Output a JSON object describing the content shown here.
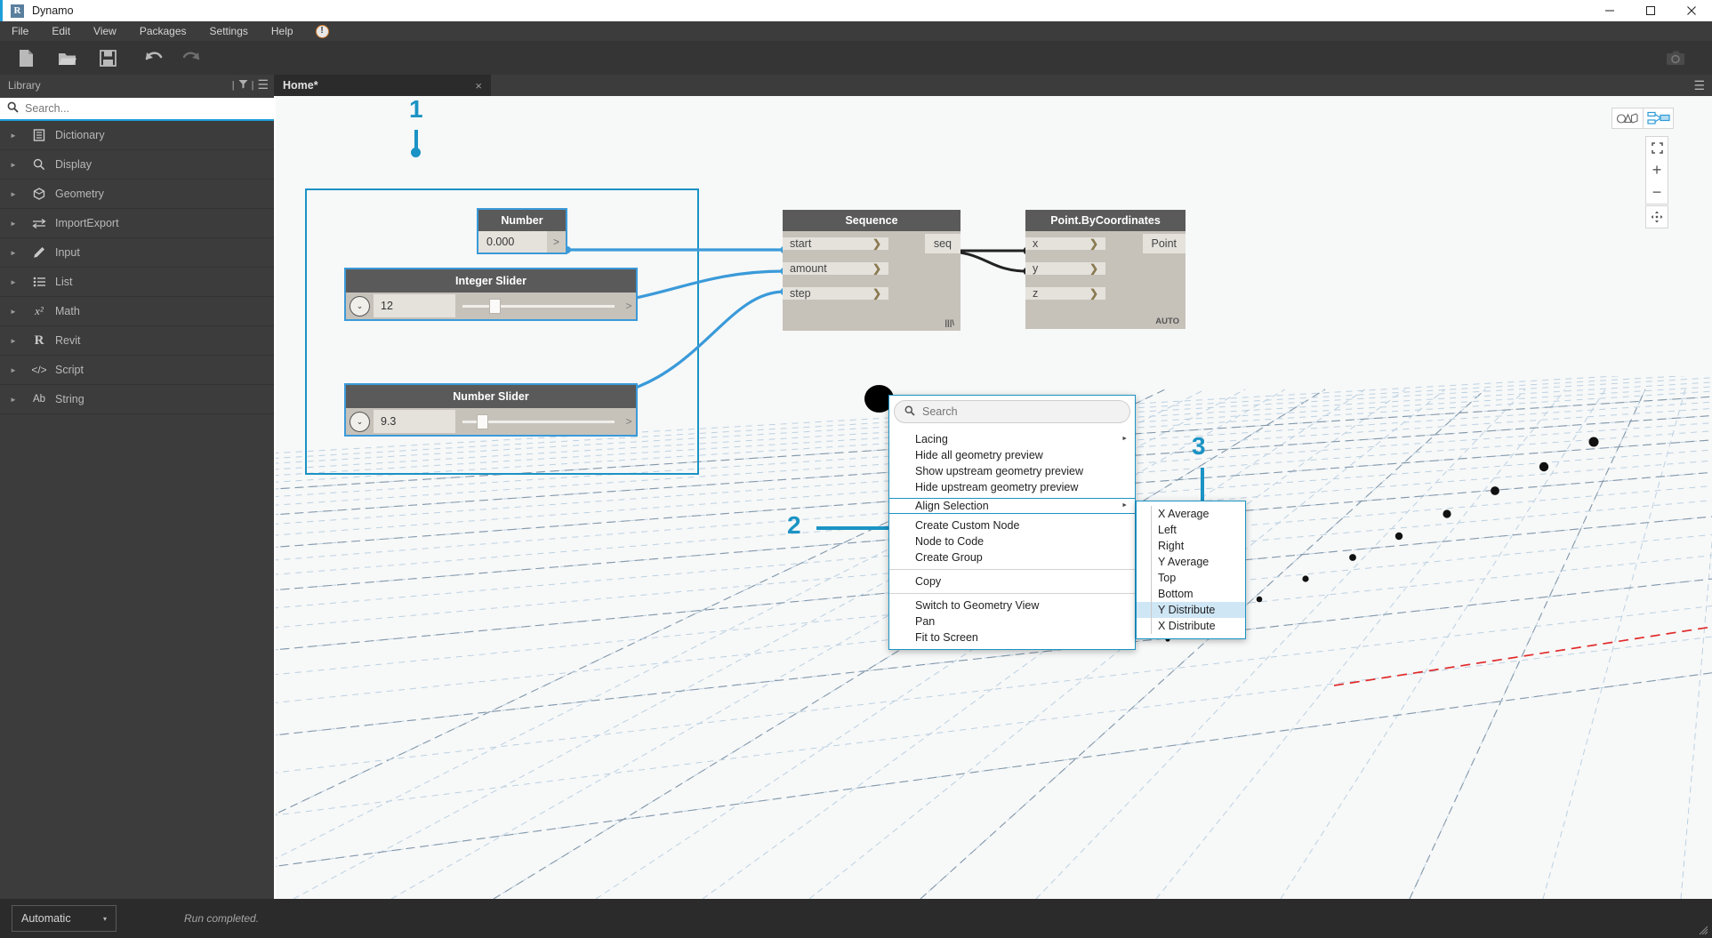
{
  "window": {
    "app_title": "Dynamo",
    "logo_letter": "R",
    "minimize": "—",
    "maximize": "☐",
    "close": "✕"
  },
  "menubar": {
    "items": [
      "File",
      "Edit",
      "View",
      "Packages",
      "Settings",
      "Help"
    ],
    "warning_icon": "!"
  },
  "toolbar": {
    "buttons": [
      "new-file-icon",
      "open-folder-icon",
      "save-icon",
      "undo-icon",
      "redo-icon"
    ],
    "camera_icon": "camera-icon"
  },
  "library": {
    "title": "Library",
    "search_placeholder": "Search...",
    "search_value": "",
    "items": [
      {
        "label": "Dictionary",
        "icon": "book-icon"
      },
      {
        "label": "Display",
        "icon": "magnifier-icon"
      },
      {
        "label": "Geometry",
        "icon": "cube-icon"
      },
      {
        "label": "ImportExport",
        "icon": "arrows-exchange-icon"
      },
      {
        "label": "Input",
        "icon": "pencil-icon"
      },
      {
        "label": "List",
        "icon": "list-icon"
      },
      {
        "label": "Math",
        "icon": "x-squared-icon"
      },
      {
        "label": "Revit",
        "icon": "revit-r-icon"
      },
      {
        "label": "Script",
        "icon": "code-brackets-icon"
      },
      {
        "label": "String",
        "icon": "ab-icon"
      }
    ]
  },
  "tabs": {
    "active": "Home*",
    "close_glyph": "×",
    "menu_glyph": "☰"
  },
  "graph": {
    "number_node": {
      "title": "Number",
      "value": "0.000",
      "out_glyph": ">"
    },
    "integer_slider": {
      "title": "Integer Slider",
      "value": "12",
      "caret": "⌄",
      "out_glyph": ">"
    },
    "number_slider": {
      "title": "Number Slider",
      "value": "9.3",
      "caret": "⌄",
      "out_glyph": ">"
    },
    "sequence_node": {
      "title": "Sequence",
      "inputs": [
        "start",
        "amount",
        "step"
      ],
      "output": "seq",
      "chevron": "❯",
      "footer": "|||\\"
    },
    "point_node": {
      "title": "Point.ByCoordinates",
      "inputs": [
        "x",
        "y",
        "z"
      ],
      "output": "Point",
      "chevron": "❯",
      "footer": "AUTO"
    }
  },
  "annotations": [
    {
      "label": "1"
    },
    {
      "label": "2"
    },
    {
      "label": "3"
    }
  ],
  "context_menu": {
    "search_placeholder": "Search",
    "search_value": "",
    "sections": [
      [
        {
          "label": "Lacing",
          "submenu": true
        },
        {
          "label": "Hide all geometry preview",
          "submenu": false
        },
        {
          "label": "Show upstream geometry preview",
          "submenu": false
        },
        {
          "label": "Hide upstream geometry preview",
          "submenu": false
        }
      ],
      [
        {
          "label": "Align Selection",
          "submenu": true,
          "highlighted": true
        }
      ],
      [
        {
          "label": "Create Custom Node",
          "submenu": false
        },
        {
          "label": "Node to Code",
          "submenu": false
        },
        {
          "label": "Create Group",
          "submenu": false
        }
      ],
      [
        {
          "label": "Copy",
          "submenu": false
        }
      ],
      [
        {
          "label": "Switch to Geometry View",
          "submenu": false
        },
        {
          "label": "Pan",
          "submenu": false
        },
        {
          "label": "Fit to Screen",
          "submenu": false
        }
      ]
    ],
    "submenu_items": [
      {
        "label": "X Average",
        "active": false
      },
      {
        "label": "Left",
        "active": false
      },
      {
        "label": "Right",
        "active": false
      },
      {
        "label": "Y Average",
        "active": false
      },
      {
        "label": "Top",
        "active": false
      },
      {
        "label": "Bottom",
        "active": false
      },
      {
        "label": "Y Distribute",
        "active": true
      },
      {
        "label": "X Distribute",
        "active": false
      }
    ]
  },
  "viewport": {
    "nav": {
      "geometry_view_icon": "geometry-shapes-icon",
      "graph_view_icon": "node-graph-icon",
      "fit_icon": "⛶",
      "zoom_in": "+",
      "zoom_out": "−",
      "pan_icon": "pan-cross-icon"
    }
  },
  "statusbar": {
    "run_mode": "Automatic",
    "run_caret": "▾",
    "status": "Run completed."
  },
  "colors": {
    "accent_blue": "#1b93c4",
    "wire_blue": "#3a9ad9",
    "node_header": "#5a5a5a",
    "node_body": "#c6c2ba",
    "dark_chrome": "#3c3c3c",
    "axis_red": "#e02020"
  }
}
